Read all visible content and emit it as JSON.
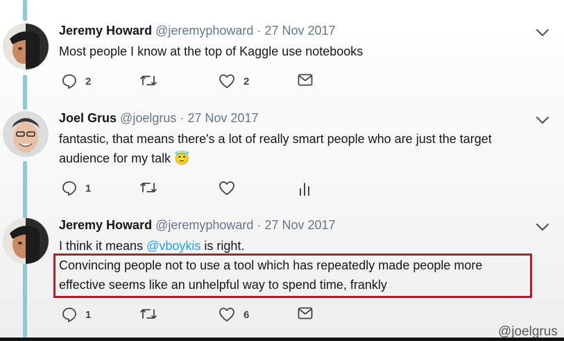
{
  "tweets": [
    {
      "name": "Jeremy Howard",
      "handle": "@jeremyphoward",
      "separator": "·",
      "date": "27 Nov 2017",
      "text": "Most people I know at the top of Kaggle use notebooks",
      "actions": {
        "replies": "2",
        "retweets": "",
        "likes": "2"
      }
    },
    {
      "name": "Joel Grus",
      "handle": "@joelgrus",
      "separator": "·",
      "date": "27 Nov 2017",
      "text_line1": "fantastic, that means there's a lot of really smart people who are just the target",
      "text_line2": "audience for my talk",
      "emoji": "😇",
      "actions": {
        "replies": "1",
        "retweets": "",
        "likes": ""
      }
    },
    {
      "name": "Jeremy Howard",
      "handle": "@jeremyphoward",
      "separator": "·",
      "date": "27 Nov 2017",
      "text_prefix": "I think it means ",
      "mention": "@vboykis",
      "text_suffix": " is right.",
      "highlight_line1": "Convincing people not to use a tool which has repeatedly made people more",
      "highlight_line2": "effective seems like an unhelpful way to spend time, frankly",
      "actions": {
        "replies": "1",
        "retweets": "",
        "likes": "6"
      }
    }
  ],
  "watermark": "@joelgrus",
  "icons": [
    "reply-icon",
    "retweet-icon",
    "like-icon",
    "dm-icon",
    "analytics-icon",
    "chevron-down-icon"
  ],
  "colors": {
    "thread_line": "#8fc9d7",
    "mention": "#1da1f2",
    "highlight_border": "#b0202a"
  }
}
